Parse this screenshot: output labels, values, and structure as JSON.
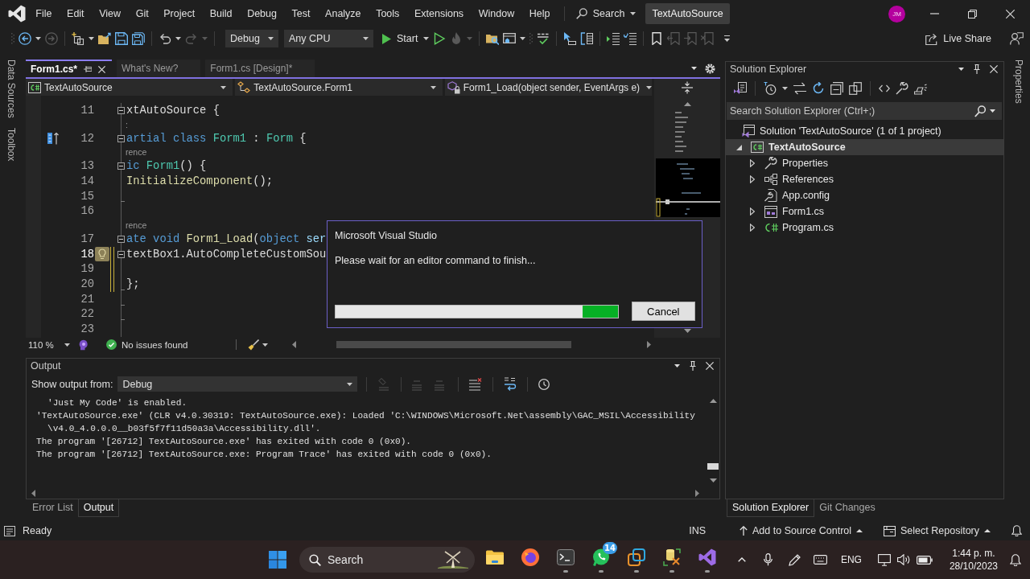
{
  "title_bar": {
    "menu": [
      "File",
      "Edit",
      "View",
      "Git",
      "Project",
      "Build",
      "Debug",
      "Test",
      "Analyze",
      "Tools",
      "Extensions",
      "Window",
      "Help"
    ],
    "search": "Search",
    "solution_title": "TextAutoSource",
    "avatar": "JM"
  },
  "toolbar": {
    "group_1": [
      {
        "disabled": false
      },
      {
        "disabled": true
      },
      {
        "disabled": false
      },
      {
        "disabled": false
      },
      {
        "disabled": false
      },
      {
        "disabled": false
      },
      {
        "disabled": false
      },
      {
        "disabled": true
      }
    ],
    "configuration": "Debug",
    "platform": "Any CPU",
    "start": "Start",
    "group_2": [
      {
        "disabled": false
      },
      {
        "disabled": true
      },
      {
        "disabled": false
      },
      {
        "disabled": false
      },
      {
        "disabled": false
      },
      {
        "disabled": false
      },
      {
        "disabled": false
      },
      {
        "disabled": false
      },
      {
        "disabled": false
      },
      {
        "disabled": false
      },
      {
        "disabled": true
      },
      {
        "disabled": true
      },
      {
        "disabled": true
      }
    ],
    "live_share": "Live Share"
  },
  "left_dock": [
    "Data Sources",
    "Toolbox"
  ],
  "editor": {
    "tabs": [
      {
        "label": "Form1.cs*",
        "selected": true
      },
      {
        "label": "What's New?",
        "selected": false
      },
      {
        "label": "Form1.cs [Design]*",
        "selected": false
      }
    ],
    "navigation": {
      "project": "TextAutoSource",
      "type": "TextAutoSource.Form1",
      "member": "Form1_Load(object sender, EventArgs e)"
    },
    "lines": [
      {
        "kind": "code",
        "number": "11",
        "current": false,
        "changed": false,
        "collapsible": true,
        "region_end": false,
        "inheritance": false,
        "lightbulb": false,
        "tokens": [
          {
            "kind": "plain",
            "text": "xtAutoSource {"
          }
        ]
      },
      {
        "kind": "codelens",
        "text": ":"
      },
      {
        "kind": "code",
        "number": "12",
        "current": false,
        "changed": false,
        "collapsible": true,
        "region_end": false,
        "inheritance": true,
        "lightbulb": false,
        "tokens": [
          {
            "kind": "keyword",
            "text": "artial class "
          },
          {
            "kind": "type",
            "text": "Form1"
          },
          {
            "kind": "plain",
            "text": " : "
          },
          {
            "kind": "type",
            "text": "Form"
          },
          {
            "kind": "plain",
            "text": " {"
          }
        ]
      },
      {
        "kind": "codelens",
        "text": "rence"
      },
      {
        "kind": "code",
        "number": "13",
        "current": false,
        "changed": false,
        "collapsible": true,
        "region_end": false,
        "inheritance": false,
        "lightbulb": false,
        "tokens": [
          {
            "kind": "keyword",
            "text": "ic "
          },
          {
            "kind": "type",
            "text": "Form1"
          },
          {
            "kind": "plain",
            "text": "() {"
          }
        ]
      },
      {
        "kind": "code",
        "number": "14",
        "current": false,
        "changed": false,
        "collapsible": false,
        "region_end": false,
        "inheritance": false,
        "lightbulb": false,
        "tokens": [
          {
            "kind": "method",
            "text": "InitializeComponent"
          },
          {
            "kind": "plain",
            "text": "();"
          }
        ]
      },
      {
        "kind": "code",
        "number": "15",
        "current": false,
        "changed": false,
        "collapsible": false,
        "region_end": true,
        "inheritance": false,
        "lightbulb": false
      },
      {
        "kind": "code",
        "number": "16",
        "current": false,
        "changed": false,
        "collapsible": false,
        "region_end": false,
        "inheritance": false,
        "lightbulb": false
      },
      {
        "kind": "codelens",
        "text": "rence"
      },
      {
        "kind": "code",
        "number": "17",
        "current": false,
        "changed": false,
        "collapsible": true,
        "region_end": false,
        "inheritance": false,
        "lightbulb": false,
        "tokens": [
          {
            "kind": "keyword",
            "text": "ate void "
          },
          {
            "kind": "method",
            "text": "Form1_Load"
          },
          {
            "kind": "plain",
            "text": "("
          },
          {
            "kind": "keyword",
            "text": "object"
          },
          {
            "kind": "param",
            "text": " ser"
          }
        ]
      },
      {
        "kind": "code",
        "number": "18",
        "current": true,
        "changed": true,
        "collapsible": true,
        "region_end": false,
        "inheritance": false,
        "lightbulb": true,
        "tokens": [
          {
            "kind": "plain",
            "text": "textBox1.AutoCompleteCustomSou"
          }
        ]
      },
      {
        "kind": "code",
        "number": "19",
        "current": false,
        "changed": true,
        "collapsible": false,
        "region_end": false,
        "inheritance": false,
        "lightbulb": false
      },
      {
        "kind": "code",
        "number": "20",
        "current": false,
        "changed": true,
        "collapsible": false,
        "region_end": true,
        "inheritance": false,
        "lightbulb": false,
        "tokens": [
          {
            "kind": "plain",
            "text": "};"
          }
        ]
      },
      {
        "kind": "code",
        "number": "21",
        "current": false,
        "changed": false,
        "collapsible": false,
        "region_end": true,
        "inheritance": false,
        "lightbulb": false
      },
      {
        "kind": "code",
        "number": "22",
        "current": false,
        "changed": false,
        "collapsible": false,
        "region_end": true,
        "inheritance": false,
        "lightbulb": false
      },
      {
        "kind": "code",
        "number": "23",
        "current": false,
        "changed": false,
        "collapsible": false,
        "region_end": false,
        "inheritance": false,
        "lightbulb": false
      }
    ],
    "zoom": "110 %",
    "issues": "No issues found"
  },
  "dialog": {
    "title": "Microsoft Visual Studio",
    "message": "Please wait for an editor command to finish...",
    "progress": {
      "indeterminate": true
    },
    "button": "Cancel"
  },
  "output": {
    "title": "Output",
    "source_label": "Show output from:",
    "source": "Debug",
    "toolbar": [
      {
        "disabled": true
      },
      {
        "disabled": true
      },
      {
        "disabled": true
      },
      {
        "disabled": false
      },
      {
        "disabled": false
      },
      {
        "disabled": false
      }
    ],
    "lines": [
      {
        "text": "'Just My Code' is enabled.",
        "continuation": true
      },
      {
        "text": "'TextAutoSource.exe' (CLR v4.0.30319: TextAutoSource.exe): Loaded 'C:\\WINDOWS\\Microsoft.Net\\assembly\\GAC_MSIL\\Accessibility",
        "continuation": false
      },
      {
        "text": "\\v4.0_4.0.0.0__b03f5f7f11d50a3a\\Accessibility.dll'.",
        "continuation": true
      },
      {
        "text": "The program '[26712] TextAutoSource.exe' has exited with code 0 (0x0).",
        "continuation": false
      },
      {
        "text": "The program '[26712] TextAutoSource.exe: Program Trace' has exited with code 0 (0x0).",
        "continuation": false
      }
    ],
    "tabs": [
      {
        "label": "Error List",
        "selected": false
      },
      {
        "label": "Output",
        "selected": true
      }
    ]
  },
  "solution_explorer": {
    "title": "Solution Explorer",
    "search_placeholder": "Search Solution Explorer (Ctrl+;)",
    "tree": [
      {
        "kind": "solution",
        "label": "Solution 'TextAutoSource' (1 of 1 project)",
        "selected": false,
        "children": [
          {
            "kind": "project",
            "label": "TextAutoSource",
            "selected": true,
            "expanded": true,
            "children": [
              {
                "kind": "properties",
                "label": "Properties",
                "selected": false,
                "expanded": false
              },
              {
                "kind": "references",
                "label": "References",
                "selected": false,
                "expanded": false
              },
              {
                "kind": "config",
                "label": "App.config",
                "selected": false
              },
              {
                "kind": "form",
                "label": "Form1.cs",
                "selected": false,
                "expanded": false
              },
              {
                "kind": "csharp",
                "label": "Program.cs",
                "selected": false,
                "expanded": false
              }
            ]
          }
        ]
      }
    ],
    "tabs": [
      {
        "label": "Solution Explorer",
        "selected": true
      },
      {
        "label": "Git Changes",
        "selected": false
      }
    ]
  },
  "right_dock": [
    "Properties"
  ],
  "status_bar": {
    "message": "Ready",
    "insert_mode": "INS",
    "source_control": "Add to Source Control",
    "repository": "Select Repository"
  },
  "taskbar": {
    "search": "Search",
    "apps": [
      {
        "running": false
      },
      {
        "running": false
      },
      {
        "running": true
      },
      {
        "running": true,
        "badge": "14"
      },
      {
        "running": true
      },
      {
        "running": true
      },
      {
        "running": true
      }
    ],
    "language": "ENG",
    "time": "1:44 p. m.",
    "date": "28/10/2023"
  }
}
